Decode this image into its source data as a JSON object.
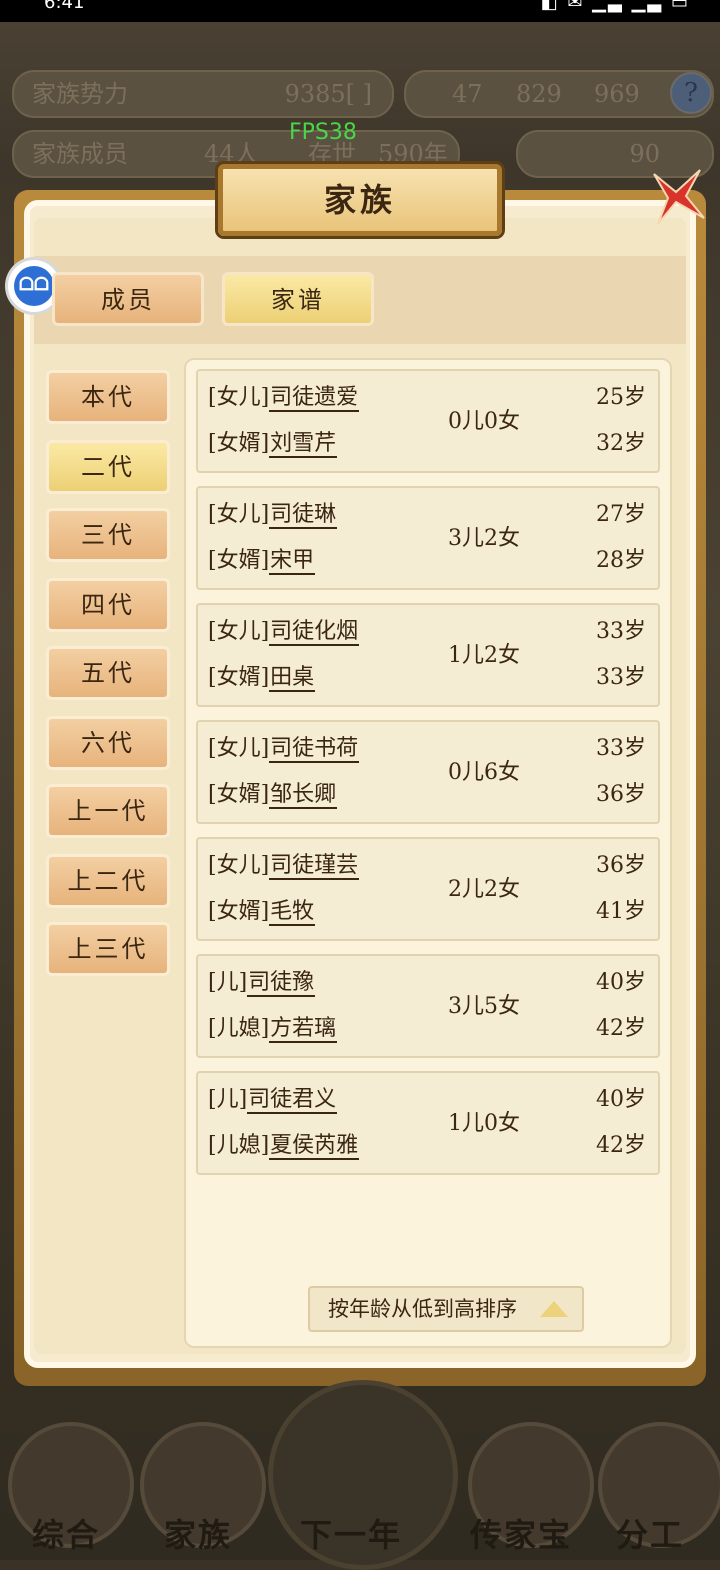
{
  "status_bar": {
    "time": "6:41",
    "icons": "◧ ✉ ▁▃ ▁▃ ▭"
  },
  "hud": {
    "clan_power_label": "家族势力",
    "clan_power_value": "9385[ ]",
    "res1": "47",
    "res2": "829",
    "res3": "969",
    "help": "?",
    "members_label": "家族成员",
    "members_value": "44人",
    "alive_label": "存世",
    "alive_value": "590年",
    "gold": "90",
    "fps": "FPS38"
  },
  "dialog": {
    "title": "家族",
    "float_button": "ᗝᗝ",
    "tabs": [
      {
        "label": "成员",
        "active": false
      },
      {
        "label": "家谱",
        "active": true
      }
    ],
    "generations": [
      {
        "label": "本代",
        "active": false
      },
      {
        "label": "二代",
        "active": true
      },
      {
        "label": "三代",
        "active": false
      },
      {
        "label": "四代",
        "active": false
      },
      {
        "label": "五代",
        "active": false
      },
      {
        "label": "六代",
        "active": false
      },
      {
        "label": "上一代",
        "active": false
      },
      {
        "label": "上二代",
        "active": false
      },
      {
        "label": "上三代",
        "active": false
      }
    ],
    "couples": [
      {
        "r1": "[女儿]",
        "n1": "司徒遗爱",
        "r2": "[女婿]",
        "n2": "刘雪芹",
        "kids": "0儿0女",
        "a1": "25岁",
        "a2": "32岁"
      },
      {
        "r1": "[女儿]",
        "n1": "司徒琳",
        "r2": "[女婿]",
        "n2": "宋甲",
        "kids": "3儿2女",
        "a1": "27岁",
        "a2": "28岁"
      },
      {
        "r1": "[女儿]",
        "n1": "司徒化烟",
        "r2": "[女婿]",
        "n2": "田桌",
        "kids": "1儿2女",
        "a1": "33岁",
        "a2": "33岁"
      },
      {
        "r1": "[女儿]",
        "n1": "司徒书荷",
        "r2": "[女婿]",
        "n2": "邹长卿",
        "kids": "0儿6女",
        "a1": "33岁",
        "a2": "36岁"
      },
      {
        "r1": "[女儿]",
        "n1": "司徒瑾芸",
        "r2": "[女婿]",
        "n2": "毛牧",
        "kids": "2儿2女",
        "a1": "36岁",
        "a2": "41岁"
      },
      {
        "r1": "[儿]",
        "n1": "司徒豫",
        "r2": "[儿媳]",
        "n2": "方若璃",
        "kids": "3儿5女",
        "a1": "40岁",
        "a2": "42岁"
      },
      {
        "r1": "[儿]",
        "n1": "司徒君义",
        "r2": "[儿媳]",
        "n2": "夏侯芮雅",
        "kids": "1儿0女",
        "a1": "40岁",
        "a2": "42岁"
      }
    ],
    "sort_label": "按年龄从低到高排序"
  },
  "bottom_nav": [
    {
      "label": "综合"
    },
    {
      "label": "家族"
    },
    {
      "label": "下一年"
    },
    {
      "label": "传家宝"
    },
    {
      "label": "分工"
    }
  ]
}
